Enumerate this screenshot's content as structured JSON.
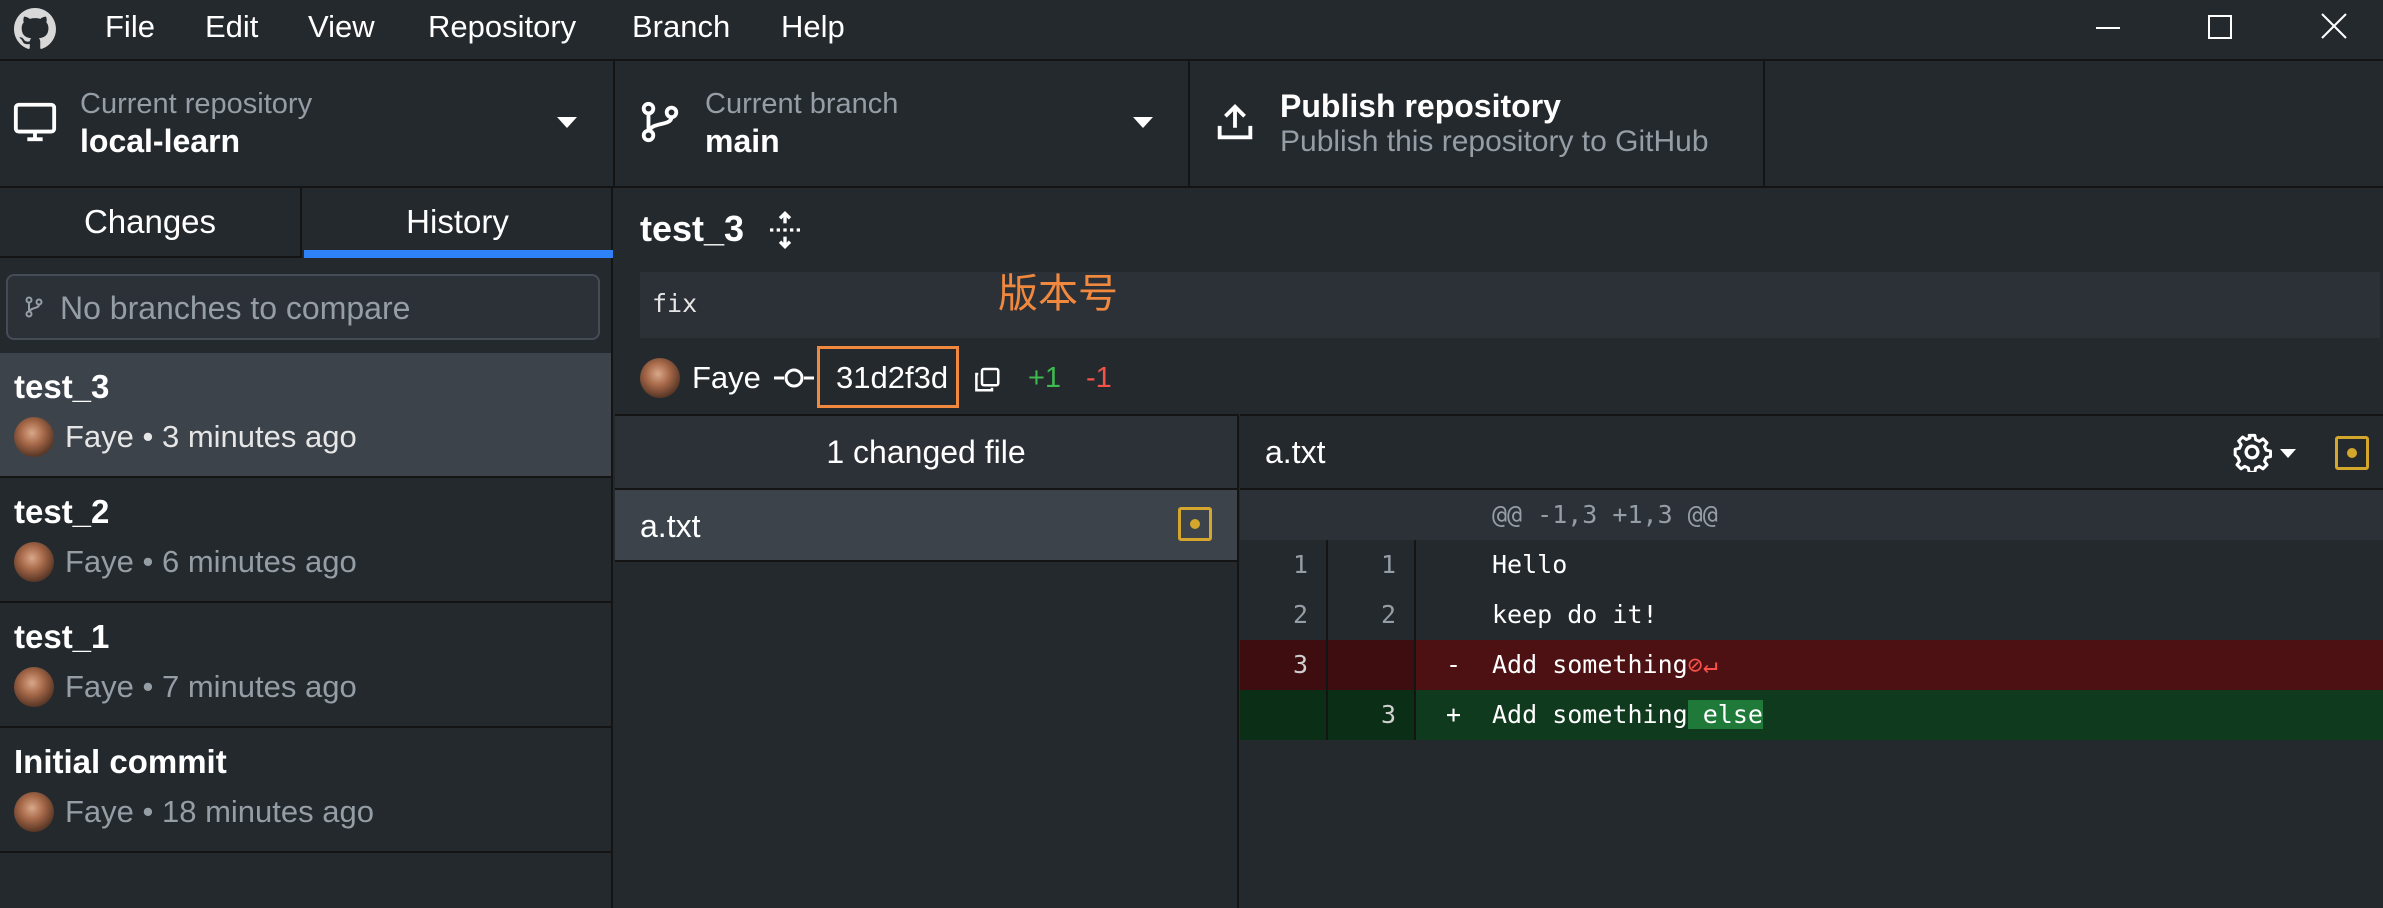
{
  "menu": [
    "File",
    "Edit",
    "View",
    "Repository",
    "Branch",
    "Help"
  ],
  "toolbar": {
    "repo_label": "Current repository",
    "repo_value": "local-learn",
    "branch_label": "Current branch",
    "branch_value": "main",
    "publish_title": "Publish repository",
    "publish_subtitle": "Publish this repository to GitHub"
  },
  "sidebar": {
    "tabs": [
      "Changes",
      "History"
    ],
    "active_tab": "History",
    "compare_placeholder": "No branches to compare",
    "commits": [
      {
        "title": "test_3",
        "meta": "Faye • 3 minutes ago",
        "selected": true
      },
      {
        "title": "test_2",
        "meta": "Faye • 6 minutes ago"
      },
      {
        "title": "test_1",
        "meta": "Faye • 7 minutes ago"
      },
      {
        "title": "Initial commit",
        "meta": "Faye • 18 minutes ago"
      }
    ]
  },
  "commit": {
    "title": "test_3",
    "body": "fix",
    "author": "Faye",
    "sha": "31d2f3d",
    "additions": "+1",
    "deletions": "-1",
    "annotation": "版本号",
    "annotation_color": "#f0883e"
  },
  "files": {
    "header": "1 changed file",
    "items": [
      {
        "name": "a.txt",
        "status": "modified"
      }
    ]
  },
  "diff": {
    "filename": "a.txt",
    "hunk": "@@ -1,3 +1,3 @@",
    "lines": [
      {
        "old": "1",
        "new": "1",
        "marker": "",
        "text": "Hello",
        "type": "context"
      },
      {
        "old": "2",
        "new": "2",
        "marker": "",
        "text": "keep do it!",
        "type": "context"
      },
      {
        "old": "3",
        "new": "",
        "marker": "-",
        "text": "Add something",
        "type": "deleted"
      },
      {
        "old": "",
        "new": "3",
        "marker": "+",
        "text": "Add something",
        "added_highlight": " else",
        "type": "added"
      }
    ]
  },
  "colors": {
    "accent": "#2f81f7",
    "added": "#3fb950",
    "deleted": "#f85149",
    "modified": "#d4a72c"
  }
}
